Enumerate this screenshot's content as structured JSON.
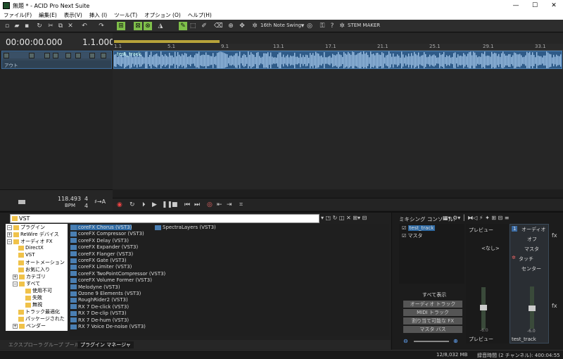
{
  "window": {
    "title": "無題 * - ACID Pro Next Suite",
    "minimize": "—",
    "maximize": "☐",
    "close": "✕"
  },
  "menu": [
    "ファイル(F)",
    "編集(E)",
    "表示(V)",
    "挿入 (I)",
    "ツール(T)",
    "オプション (O)",
    "ヘルプ(H)"
  ],
  "toolbar": {
    "swing": "16th Note Swing",
    "stem": "STEM MAKER"
  },
  "time": {
    "position": "00:00:00.000",
    "measure": "1.1.000"
  },
  "ruler": [
    "1.1",
    "5.1",
    "9.1",
    "13.1",
    "17.1",
    "21.1",
    "25.1",
    "29.1",
    "33.1"
  ],
  "track": {
    "clip": "test_track",
    "mode": "アウト"
  },
  "tempo": {
    "bpm": "118.493",
    "bpm_label": "BPM",
    "sig_top": "4",
    "sig_bottom": "4"
  },
  "explorer": {
    "path": "VST",
    "tree": [
      "プラグイン",
      "ReWire デバイス",
      "オーディオ FX",
      "DirectX",
      "VST",
      "オートメーション",
      "お気に入り",
      "カテゴリ",
      "すべて",
      "使用不可",
      "失敗",
      "無視",
      "トラック最適化",
      "パッケージされた",
      "ベンダー"
    ],
    "files": [
      "coreFX Chorus (VST3)",
      "coreFX Compressor (VST3)",
      "coreFX Delay (VST3)",
      "coreFX Expander (VST3)",
      "coreFX Flanger (VST3)",
      "coreFX Gate (VST3)",
      "coreFX Limiter (VST3)",
      "coreFX TwoPointCompressor (VST3)",
      "coreFX Volume Former (VST3)",
      "Melodyne (VST3)",
      "Ozone 9 Elements (VST3)",
      "RoughRider2 (VST3)",
      "RX 7 De-click (VST3)",
      "RX 7 De-clip (VST3)",
      "RX 7 De-hum (VST3)",
      "RX 7 Voice De-noise (VST3)"
    ],
    "files_col2": [
      "SpectraLayers (VST3)"
    ],
    "tabs": [
      "エクスプローラ",
      "グループ プール",
      "プラグイン マネージャ"
    ]
  },
  "mixer": {
    "title": "ミキシング コンソール:",
    "items": [
      "test_track",
      "マスタ"
    ],
    "show_all": "すべて表示",
    "buttons": [
      "オーディオ トラック",
      "MIDI トラック",
      "割り当て可能な FX",
      "マスタ バス"
    ],
    "preview": "プレビュー",
    "none": "<なし>",
    "preview_db": "-6.0",
    "preview_label": "プレビュー",
    "track_num": "1",
    "audio": "オーディオ",
    "off": "オフ",
    "master": "マスタ",
    "touch": "タッチ",
    "center": "センター",
    "track_db": "-6.0",
    "track_name": "test_track"
  },
  "status": {
    "memory": "12/8,032 MB",
    "rec": "録音時間 (2 チャンネル): 400:04:55"
  }
}
